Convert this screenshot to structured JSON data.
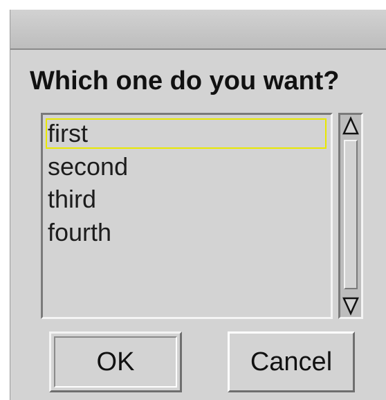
{
  "dialog": {
    "title": "",
    "prompt": "Which one do you want?"
  },
  "listbox": {
    "items": [
      {
        "label": "first",
        "selected": true
      },
      {
        "label": "second",
        "selected": false
      },
      {
        "label": "third",
        "selected": false
      },
      {
        "label": "fourth",
        "selected": false
      }
    ]
  },
  "scrollbar": {
    "up_icon": "triangle-up-icon",
    "down_icon": "triangle-down-icon"
  },
  "buttons": {
    "ok_label": "OK",
    "cancel_label": "Cancel"
  },
  "colors": {
    "dialog_bg": "#d3d3d3",
    "selection_outline": "#e8e800",
    "text": "#111111"
  }
}
